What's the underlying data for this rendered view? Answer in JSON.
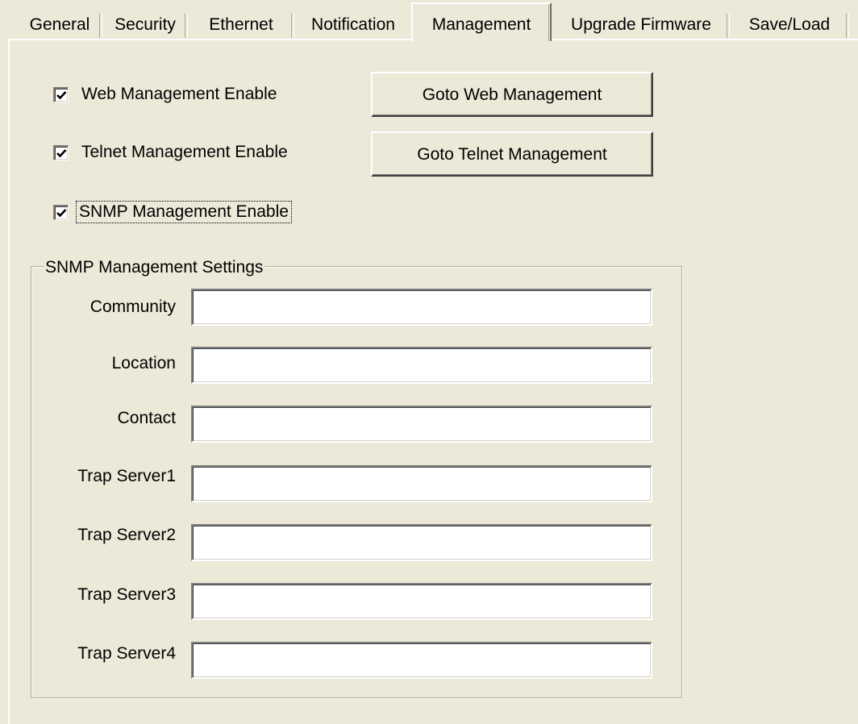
{
  "tabs": [
    {
      "label": "General"
    },
    {
      "label": "Security"
    },
    {
      "label": "Ethernet"
    },
    {
      "label": "Notification"
    },
    {
      "label": "Management",
      "active": true
    },
    {
      "label": "Upgrade Firmware"
    },
    {
      "label": "Save/Load"
    }
  ],
  "management": {
    "web": {
      "label": "Web Management Enable",
      "checked": true,
      "button": "Goto Web Management"
    },
    "telnet": {
      "label": "Telnet Management Enable",
      "checked": true,
      "button": "Goto Telnet Management"
    },
    "snmp": {
      "label": "SNMP Management Enable",
      "checked": true
    }
  },
  "snmp_settings": {
    "title": "SNMP Management Settings",
    "fields": [
      {
        "label": "Community",
        "value": ""
      },
      {
        "label": "Location",
        "value": ""
      },
      {
        "label": "Contact",
        "value": ""
      },
      {
        "label": "Trap Server1",
        "value": ""
      },
      {
        "label": "Trap Server2",
        "value": ""
      },
      {
        "label": "Trap Server3",
        "value": ""
      },
      {
        "label": "Trap Server4",
        "value": ""
      }
    ]
  }
}
